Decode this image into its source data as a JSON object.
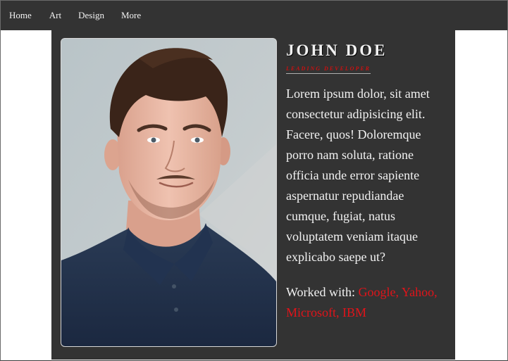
{
  "nav": {
    "items": [
      {
        "label": "Home"
      },
      {
        "label": "Art"
      },
      {
        "label": "Design"
      },
      {
        "label": "More"
      }
    ]
  },
  "profile": {
    "name": "JOHN DOE",
    "role": "LEADING DEVELOPER",
    "bio": "Lorem ipsum dolor, sit amet consectetur adipisicing elit. Facere, quos! Doloremque porro nam soluta, ratione officia unde error sapiente aspernatur repudiandae cumque, fugiat, natus voluptatem veniam itaque explicabo saepe ut?",
    "worked_with_label": "Worked with:",
    "companies": [
      "Google,",
      "Yahoo,",
      "Microsoft,",
      "IBM"
    ]
  },
  "colors": {
    "page_bg": "#ffffff",
    "nav_bg": "#333333",
    "card_bg": "#333333",
    "text": "#f2f2f2",
    "accent": "#e0141a",
    "role": "#cc1010"
  }
}
